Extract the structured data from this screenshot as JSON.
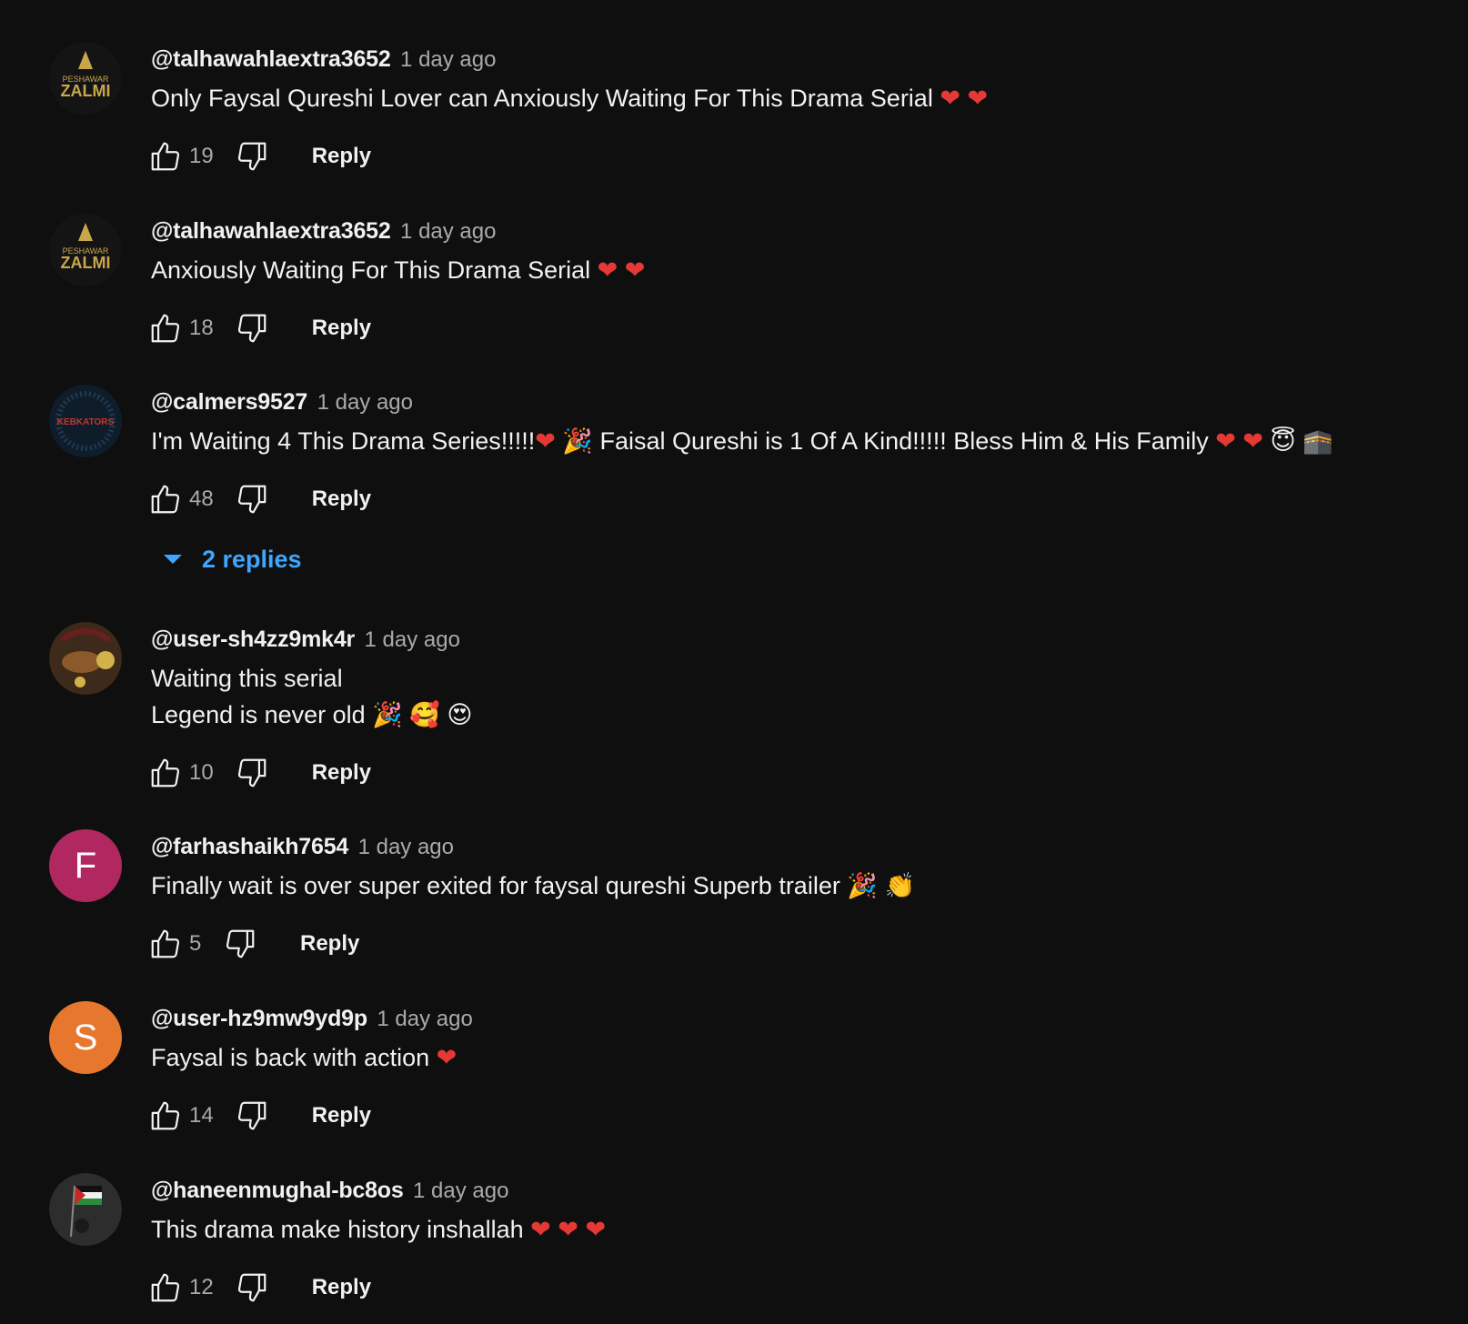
{
  "comments": [
    {
      "author": "@talhawahlaextra3652",
      "time": "1 day ago",
      "lines": [
        "Only Faysal Qureshi Lover can Anxiously Waiting For This Drama Serial ❤️ ❤️"
      ],
      "likes": "19",
      "reply_label": "Reply",
      "avatar": {
        "type": "logo",
        "text": "ZALMI",
        "subtext": "PESHAWAR",
        "color": "#c9a64a"
      }
    },
    {
      "author": "@talhawahlaextra3652",
      "time": "1 day ago",
      "lines": [
        "Anxiously Waiting For This Drama Serial ❤️ ❤️"
      ],
      "likes": "18",
      "reply_label": "Reply",
      "avatar": {
        "type": "logo",
        "text": "ZALMI",
        "subtext": "PESHAWAR",
        "color": "#c9a64a"
      }
    },
    {
      "author": "@calmers9527",
      "time": "1 day ago",
      "lines": [
        "I'm Waiting 4 This Drama Series!!!!!❤️ 🎉 Faisal Qureshi is 1 Of A Kind!!!!! Bless Him & His Family ❤️ ❤️ 😇 🕋"
      ],
      "likes": "48",
      "reply_label": "Reply",
      "replies_label": "2 replies",
      "avatar": {
        "type": "logo",
        "text": "KEBKATORS",
        "color": "#c0392b"
      }
    },
    {
      "author": "@user-sh4zz9mk4r",
      "time": "1 day ago",
      "lines": [
        "Waiting this serial",
        "Legend is never old 🎉 🥰 😍"
      ],
      "likes": "10",
      "reply_label": "Reply",
      "avatar": {
        "type": "photo",
        "color": "#8a5a2b"
      }
    },
    {
      "author": "@farhashaikh7654",
      "time": "1 day ago",
      "lines": [
        "Finally wait is over super exited for faysal qureshi Superb trailer 🎉 👏"
      ],
      "likes": "5",
      "reply_label": "Reply",
      "avatar": {
        "type": "letter",
        "letter": "F",
        "color": "#b0285f"
      }
    },
    {
      "author": "@user-hz9mw9yd9p",
      "time": "1 day ago",
      "lines": [
        "Faysal is back with action ❤️"
      ],
      "likes": "14",
      "reply_label": "Reply",
      "avatar": {
        "type": "letter",
        "letter": "S",
        "color": "#e8772e"
      }
    },
    {
      "author": "@haneenmughal-bc8os",
      "time": "1 day ago",
      "lines": [
        "This drama make history inshallah ❤️ ❤️ ❤️"
      ],
      "likes": "12",
      "reply_label": "Reply",
      "avatar": {
        "type": "flag",
        "color": "#2d2d2d"
      }
    }
  ]
}
